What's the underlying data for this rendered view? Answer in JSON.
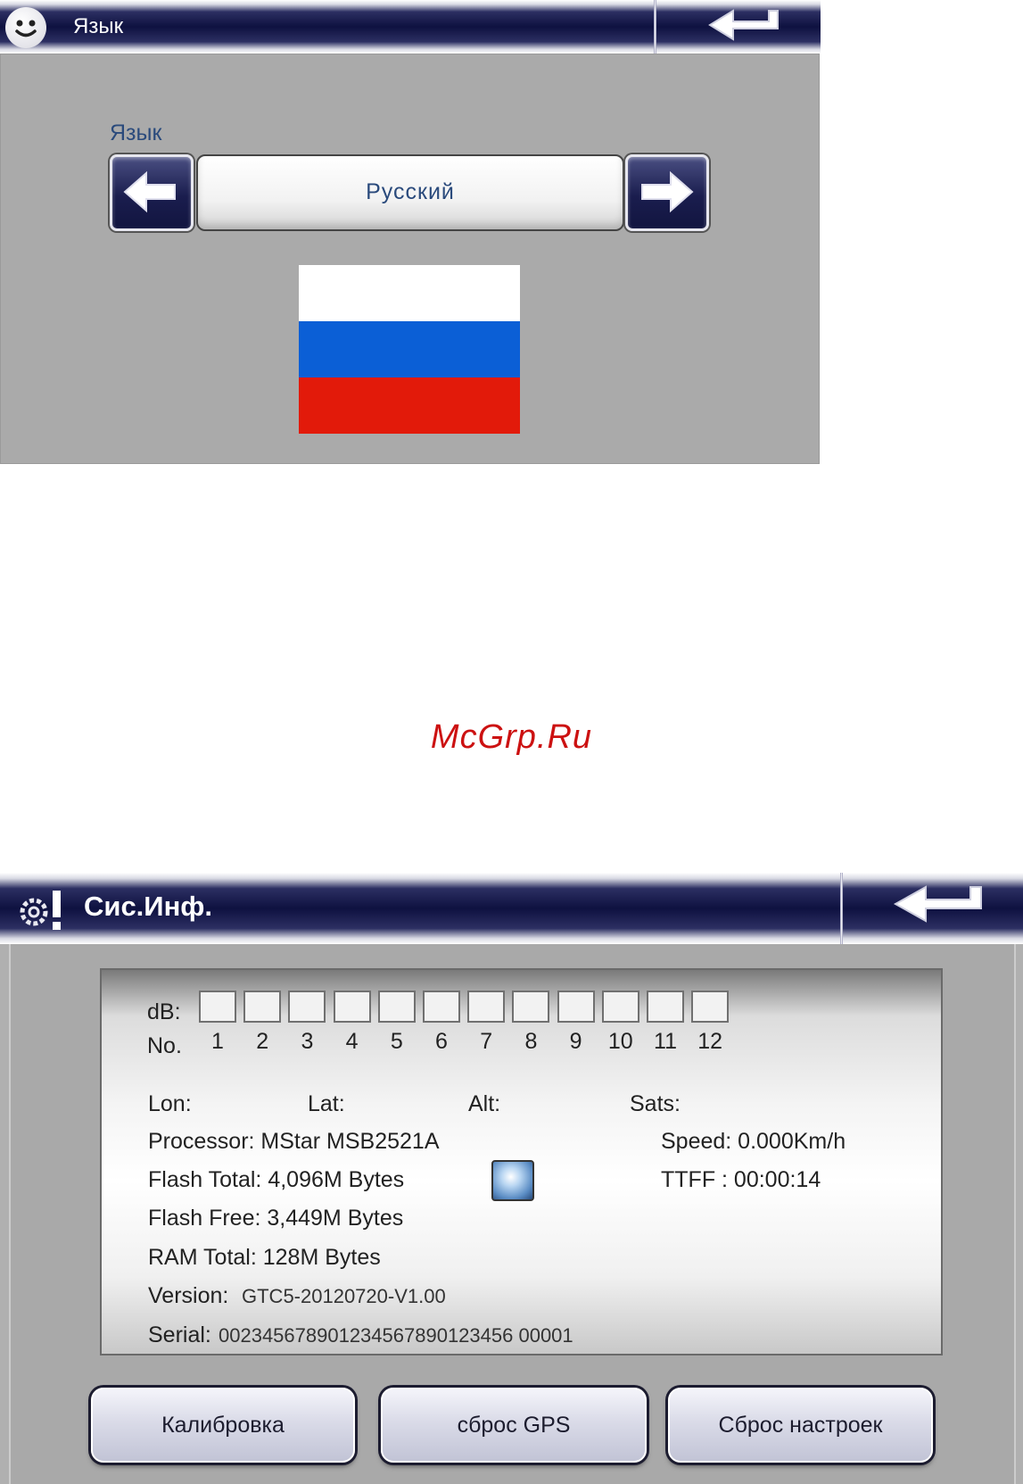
{
  "language_screen": {
    "header_title": "Язык",
    "field_label": "Язык",
    "selected_language": "Русский",
    "flag_colors": [
      "#ffffff",
      "#0b5fd6",
      "#e21a0a"
    ]
  },
  "watermark": "McGrp.Ru",
  "sysinfo_screen": {
    "header_title": "Сис.Инф.",
    "db_label": "dB:",
    "no_label": "No.",
    "satellites": [
      "1",
      "2",
      "3",
      "4",
      "5",
      "6",
      "7",
      "8",
      "9",
      "10",
      "11",
      "12"
    ],
    "lon_label": "Lon:",
    "lat_label": "Lat:",
    "alt_label": "Alt:",
    "sats_label": "Sats:",
    "processor": "Processor: MStar MSB2521A",
    "speed": "Speed: 0.000Km/h",
    "flash_total": "Flash Total: 4,096M Bytes",
    "ttff": "TTFF : 00:00:14",
    "flash_free": "Flash Free: 3,449M Bytes",
    "ram_total": "RAM Total: 128M Bytes",
    "version_label": "Version:",
    "version_value": "GTC5-20120720-V1.00",
    "serial_label": "Serial:",
    "serial_value": "002345678901234567890123456 00001",
    "buttons": {
      "calibrate": "Калибровка",
      "reset_gps": "сброс GPS",
      "reset_settings": "Сброс настроек"
    }
  }
}
